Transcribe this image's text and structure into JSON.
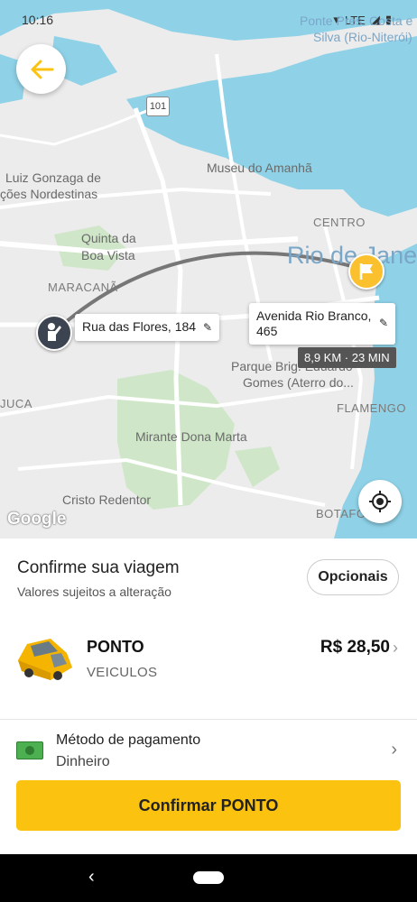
{
  "status": {
    "time": "10:16",
    "network": "LTE"
  },
  "map": {
    "labels": {
      "poi_top_right_1": "Ponte Pres. Costa e",
      "poi_top_right_2": "Silva (Rio-Niterói)",
      "road_101": "101",
      "museu": "Museu do Amanhã",
      "luiz_1": "Luiz Gonzaga de",
      "luiz_2": "ções Nordestinas",
      "quinta_1": "Quinta da",
      "quinta_2": "Boa Vista",
      "centro": "CENTRO",
      "rio": "Rio de Jane",
      "maracana": "MARACANÃ",
      "parque_1": "Parque Brig. Eduardo",
      "parque_2": "Gomes (Aterro do...",
      "tijuca": "JUCA",
      "flamengo": "FLAMENGO",
      "mirante": "Mirante Dona Marta",
      "cristo": "Cristo Redentor",
      "botafogo": "BOTAFOGO",
      "google": "Google"
    },
    "origin_address": "Rua das Flores, 184",
    "destination_address": "Avenida Rio Branco, 465",
    "eta": "8,9 KM · 23 MIN"
  },
  "sheet": {
    "title": "Confirme sua viagem",
    "subtitle": "Valores sujeitos a alteração",
    "options_label": "Opcionais",
    "ride": {
      "name": "PONTO",
      "type": "VEICULOS",
      "price": "R$ 28,50"
    },
    "payment": {
      "label": "Método de pagamento",
      "value": "Dinheiro"
    },
    "confirm_label": "Confirmar PONTO"
  },
  "colors": {
    "accent": "#fbc20f",
    "water": "#8fd2e8",
    "map_land": "#ececec",
    "route": "#777777"
  }
}
